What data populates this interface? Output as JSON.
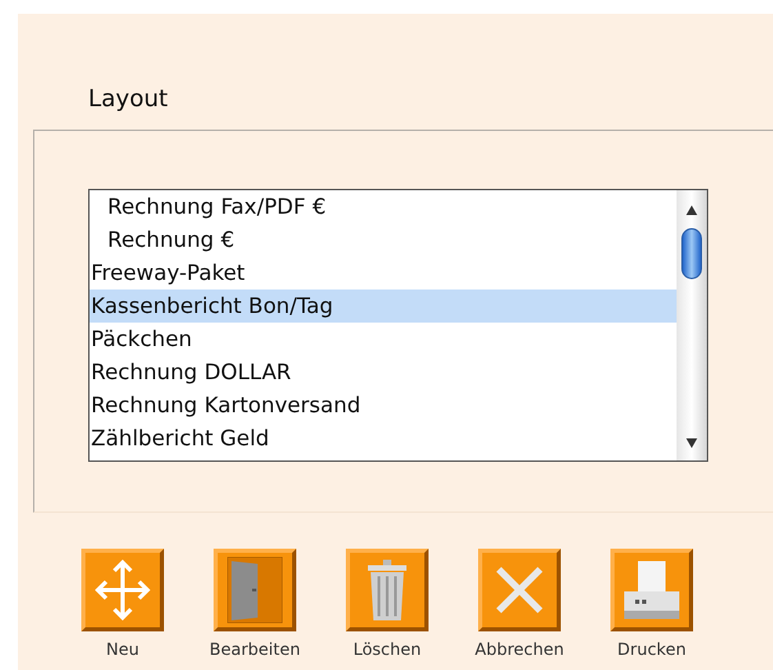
{
  "section": {
    "title": "Layout"
  },
  "layouts": [
    {
      "label": "Rechnung Fax/PDF €",
      "indented": true,
      "selected": false
    },
    {
      "label": "Rechnung €",
      "indented": true,
      "selected": false
    },
    {
      "label": "Freeway-Paket",
      "indented": false,
      "selected": false
    },
    {
      "label": "Kassenbericht Bon/Tag",
      "indented": false,
      "selected": true
    },
    {
      "label": "Päckchen",
      "indented": false,
      "selected": false
    },
    {
      "label": "Rechnung DOLLAR",
      "indented": false,
      "selected": false
    },
    {
      "label": "Rechnung Kartonversand",
      "indented": false,
      "selected": false
    },
    {
      "label": "Zählbericht Geld",
      "indented": false,
      "selected": false
    }
  ],
  "buttons": [
    {
      "kind": "new",
      "label": "Neu"
    },
    {
      "kind": "edit",
      "label": "Bearbeiten"
    },
    {
      "kind": "delete",
      "label": "Löschen"
    },
    {
      "kind": "cancel",
      "label": "Abbrechen"
    },
    {
      "kind": "print",
      "label": "Drucken"
    }
  ]
}
